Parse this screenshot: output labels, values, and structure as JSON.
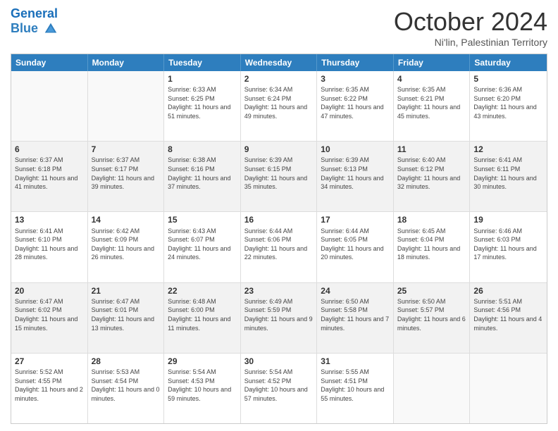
{
  "header": {
    "logo_line1": "General",
    "logo_line2": "Blue",
    "month_title": "October 2024",
    "subtitle": "Ni'lin, Palestinian Territory"
  },
  "weekdays": [
    "Sunday",
    "Monday",
    "Tuesday",
    "Wednesday",
    "Thursday",
    "Friday",
    "Saturday"
  ],
  "rows": [
    [
      {
        "day": "",
        "sunrise": "",
        "sunset": "",
        "daylight": ""
      },
      {
        "day": "",
        "sunrise": "",
        "sunset": "",
        "daylight": ""
      },
      {
        "day": "1",
        "sunrise": "Sunrise: 6:33 AM",
        "sunset": "Sunset: 6:25 PM",
        "daylight": "Daylight: 11 hours and 51 minutes."
      },
      {
        "day": "2",
        "sunrise": "Sunrise: 6:34 AM",
        "sunset": "Sunset: 6:24 PM",
        "daylight": "Daylight: 11 hours and 49 minutes."
      },
      {
        "day": "3",
        "sunrise": "Sunrise: 6:35 AM",
        "sunset": "Sunset: 6:22 PM",
        "daylight": "Daylight: 11 hours and 47 minutes."
      },
      {
        "day": "4",
        "sunrise": "Sunrise: 6:35 AM",
        "sunset": "Sunset: 6:21 PM",
        "daylight": "Daylight: 11 hours and 45 minutes."
      },
      {
        "day": "5",
        "sunrise": "Sunrise: 6:36 AM",
        "sunset": "Sunset: 6:20 PM",
        "daylight": "Daylight: 11 hours and 43 minutes."
      }
    ],
    [
      {
        "day": "6",
        "sunrise": "Sunrise: 6:37 AM",
        "sunset": "Sunset: 6:18 PM",
        "daylight": "Daylight: 11 hours and 41 minutes."
      },
      {
        "day": "7",
        "sunrise": "Sunrise: 6:37 AM",
        "sunset": "Sunset: 6:17 PM",
        "daylight": "Daylight: 11 hours and 39 minutes."
      },
      {
        "day": "8",
        "sunrise": "Sunrise: 6:38 AM",
        "sunset": "Sunset: 6:16 PM",
        "daylight": "Daylight: 11 hours and 37 minutes."
      },
      {
        "day": "9",
        "sunrise": "Sunrise: 6:39 AM",
        "sunset": "Sunset: 6:15 PM",
        "daylight": "Daylight: 11 hours and 35 minutes."
      },
      {
        "day": "10",
        "sunrise": "Sunrise: 6:39 AM",
        "sunset": "Sunset: 6:13 PM",
        "daylight": "Daylight: 11 hours and 34 minutes."
      },
      {
        "day": "11",
        "sunrise": "Sunrise: 6:40 AM",
        "sunset": "Sunset: 6:12 PM",
        "daylight": "Daylight: 11 hours and 32 minutes."
      },
      {
        "day": "12",
        "sunrise": "Sunrise: 6:41 AM",
        "sunset": "Sunset: 6:11 PM",
        "daylight": "Daylight: 11 hours and 30 minutes."
      }
    ],
    [
      {
        "day": "13",
        "sunrise": "Sunrise: 6:41 AM",
        "sunset": "Sunset: 6:10 PM",
        "daylight": "Daylight: 11 hours and 28 minutes."
      },
      {
        "day": "14",
        "sunrise": "Sunrise: 6:42 AM",
        "sunset": "Sunset: 6:09 PM",
        "daylight": "Daylight: 11 hours and 26 minutes."
      },
      {
        "day": "15",
        "sunrise": "Sunrise: 6:43 AM",
        "sunset": "Sunset: 6:07 PM",
        "daylight": "Daylight: 11 hours and 24 minutes."
      },
      {
        "day": "16",
        "sunrise": "Sunrise: 6:44 AM",
        "sunset": "Sunset: 6:06 PM",
        "daylight": "Daylight: 11 hours and 22 minutes."
      },
      {
        "day": "17",
        "sunrise": "Sunrise: 6:44 AM",
        "sunset": "Sunset: 6:05 PM",
        "daylight": "Daylight: 11 hours and 20 minutes."
      },
      {
        "day": "18",
        "sunrise": "Sunrise: 6:45 AM",
        "sunset": "Sunset: 6:04 PM",
        "daylight": "Daylight: 11 hours and 18 minutes."
      },
      {
        "day": "19",
        "sunrise": "Sunrise: 6:46 AM",
        "sunset": "Sunset: 6:03 PM",
        "daylight": "Daylight: 11 hours and 17 minutes."
      }
    ],
    [
      {
        "day": "20",
        "sunrise": "Sunrise: 6:47 AM",
        "sunset": "Sunset: 6:02 PM",
        "daylight": "Daylight: 11 hours and 15 minutes."
      },
      {
        "day": "21",
        "sunrise": "Sunrise: 6:47 AM",
        "sunset": "Sunset: 6:01 PM",
        "daylight": "Daylight: 11 hours and 13 minutes."
      },
      {
        "day": "22",
        "sunrise": "Sunrise: 6:48 AM",
        "sunset": "Sunset: 6:00 PM",
        "daylight": "Daylight: 11 hours and 11 minutes."
      },
      {
        "day": "23",
        "sunrise": "Sunrise: 6:49 AM",
        "sunset": "Sunset: 5:59 PM",
        "daylight": "Daylight: 11 hours and 9 minutes."
      },
      {
        "day": "24",
        "sunrise": "Sunrise: 6:50 AM",
        "sunset": "Sunset: 5:58 PM",
        "daylight": "Daylight: 11 hours and 7 minutes."
      },
      {
        "day": "25",
        "sunrise": "Sunrise: 6:50 AM",
        "sunset": "Sunset: 5:57 PM",
        "daylight": "Daylight: 11 hours and 6 minutes."
      },
      {
        "day": "26",
        "sunrise": "Sunrise: 5:51 AM",
        "sunset": "Sunset: 4:56 PM",
        "daylight": "Daylight: 11 hours and 4 minutes."
      }
    ],
    [
      {
        "day": "27",
        "sunrise": "Sunrise: 5:52 AM",
        "sunset": "Sunset: 4:55 PM",
        "daylight": "Daylight: 11 hours and 2 minutes."
      },
      {
        "day": "28",
        "sunrise": "Sunrise: 5:53 AM",
        "sunset": "Sunset: 4:54 PM",
        "daylight": "Daylight: 11 hours and 0 minutes."
      },
      {
        "day": "29",
        "sunrise": "Sunrise: 5:54 AM",
        "sunset": "Sunset: 4:53 PM",
        "daylight": "Daylight: 10 hours and 59 minutes."
      },
      {
        "day": "30",
        "sunrise": "Sunrise: 5:54 AM",
        "sunset": "Sunset: 4:52 PM",
        "daylight": "Daylight: 10 hours and 57 minutes."
      },
      {
        "day": "31",
        "sunrise": "Sunrise: 5:55 AM",
        "sunset": "Sunset: 4:51 PM",
        "daylight": "Daylight: 10 hours and 55 minutes."
      },
      {
        "day": "",
        "sunrise": "",
        "sunset": "",
        "daylight": ""
      },
      {
        "day": "",
        "sunrise": "",
        "sunset": "",
        "daylight": ""
      }
    ]
  ]
}
